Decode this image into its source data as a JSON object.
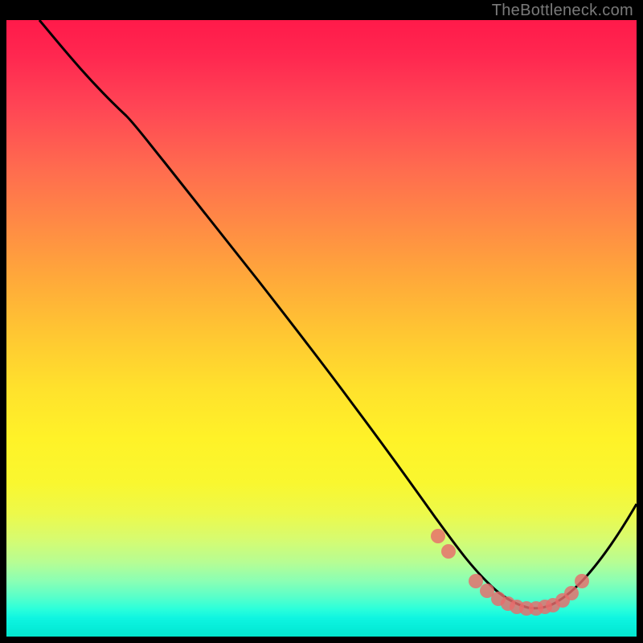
{
  "attribution": "TheBottleneck.com",
  "colors": {
    "frame_bg": "#000000",
    "curve_stroke": "#000000",
    "dot_fill": "#e86b6b",
    "gradient_top": "#ff1a4a",
    "gradient_bottom": "#04e6cf"
  },
  "chart_data": {
    "type": "line",
    "title": "",
    "xlabel": "",
    "ylabel": "",
    "xlim": [
      0,
      100
    ],
    "ylim": [
      0,
      100
    ],
    "note": "No visible axis ticks; values estimated from pixel positions on a 0-100 normalized scale (x left-to-right, y representing curve height where 0 = top, 100 = bottom of plot).",
    "series": [
      {
        "name": "bottleneck-curve",
        "x": [
          5.2,
          10,
          15,
          19,
          25,
          30,
          35,
          40,
          45,
          50,
          55,
          60,
          65,
          68,
          70,
          72,
          74,
          76,
          78,
          80,
          82,
          84,
          86,
          88,
          90,
          92,
          95,
          100
        ],
        "y_from_top_pct": [
          0,
          5.5,
          11.2,
          15.5,
          23,
          30,
          37,
          44,
          51,
          58,
          65,
          72,
          79,
          83.2,
          86,
          88.5,
          90.5,
          92.2,
          93.6,
          94.6,
          95.2,
          95.4,
          95.1,
          94.3,
          92.8,
          90.6,
          86.5,
          78.5
        ]
      }
    ],
    "highlight_points": {
      "name": "marker-dots",
      "x": [
        68.5,
        70.2,
        74.5,
        76.3,
        78.0,
        79.6,
        81.0,
        82.5,
        84.0,
        85.4,
        86.7,
        88.2,
        89.7,
        91.3
      ],
      "y_from_top_pct": [
        83.7,
        86.2,
        91.0,
        92.5,
        93.9,
        94.7,
        95.2,
        95.4,
        95.4,
        95.2,
        95.0,
        94.2,
        93.0,
        91.0
      ]
    }
  }
}
